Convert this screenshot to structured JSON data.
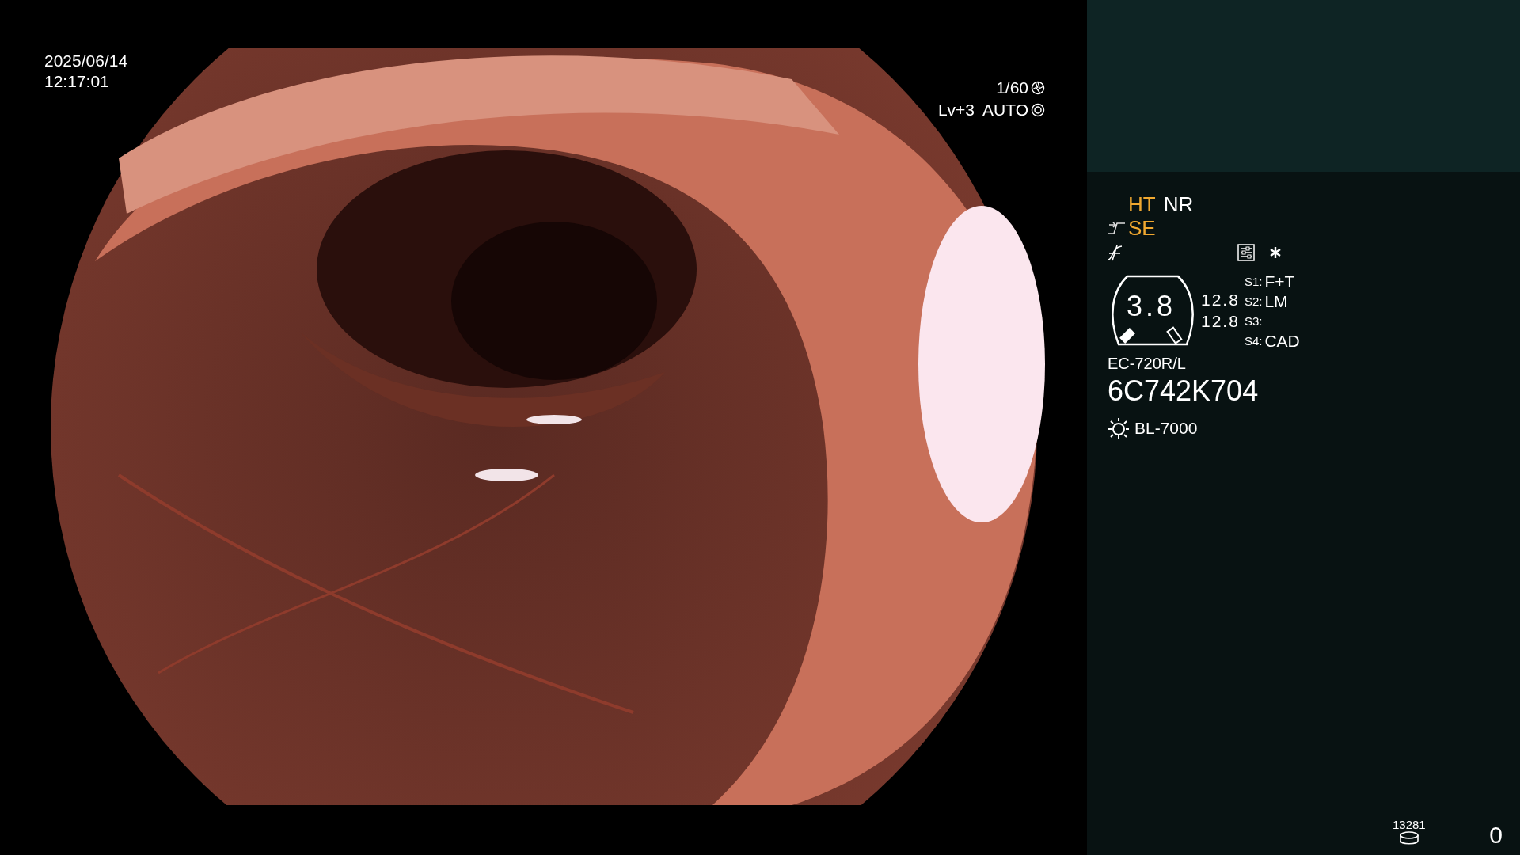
{
  "timestamp": {
    "date": "2025/06/14",
    "time": "12:17:01"
  },
  "exposure": {
    "shutter": "1/60",
    "level": "Lv+3",
    "mode": "AUTO"
  },
  "image_modes": [
    {
      "label": "HT",
      "color": "#f0a830"
    },
    {
      "label": "NR",
      "color": "#ffffff"
    }
  ],
  "enhancement": {
    "label": "SE",
    "color": "#f0a830"
  },
  "gauge": {
    "value": "3.8",
    "readings": [
      "12.8",
      "12.8"
    ]
  },
  "switches": [
    {
      "key": "S1:",
      "value": "F+T"
    },
    {
      "key": "S2:",
      "value": "LM"
    },
    {
      "key": "S3:"
    },
    {
      "key": "S4:",
      "value": "CAD"
    }
  ],
  "scope": {
    "model": "EC-720R/L",
    "serial": "6C742K704"
  },
  "light_source": "BL-7000",
  "storage": {
    "count": "13281"
  },
  "counter": "0"
}
